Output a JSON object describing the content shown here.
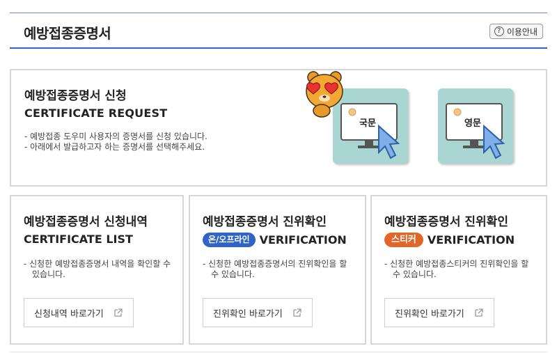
{
  "header": {
    "title": "예방접종증명서",
    "help_label": "이용안내",
    "help_icon": "question-circle-icon"
  },
  "request": {
    "title": "예방접종증명서 신청",
    "subtitle": "CERTIFICATE REQUEST",
    "desc": [
      "- 예방접종 도우미 사용자의 증명서를 신청 있습니다.",
      "- 아래에서 발급하고자 하는 증명서를 선택해주세요."
    ],
    "tiles": [
      {
        "label": "국문",
        "icon": "monitor-cursor-icon"
      },
      {
        "label": "영문",
        "icon": "monitor-cursor-icon"
      }
    ]
  },
  "cards": [
    {
      "title": "예방접종증명서 신청내역",
      "subtitle": "CERTIFICATE LIST",
      "badge": "",
      "desc": "- 신청한 예방접종증명서 내역을 확인할 수 있습니다.",
      "button": "신청내역 바로가기"
    },
    {
      "title": "예방접종증명서 진위확인",
      "subtitle": "VERIFICATION",
      "badge": "온/오프라인",
      "desc": "- 신청한 예방접종증명서의 진위확인을 할 수 있습니다.",
      "button": "진위확인 바로가기"
    },
    {
      "title": "예방접종증명서 진위확인",
      "subtitle": "VERIFICATION",
      "badge": "스티커",
      "desc": "- 신청한 예방접종스티커의 진위확인을 할 수 있습니다.",
      "button": "진위확인 바로가기"
    }
  ],
  "colors": {
    "accent": "#2f63c5",
    "orange": "#e0662a",
    "tile": "#a9d6d2"
  }
}
